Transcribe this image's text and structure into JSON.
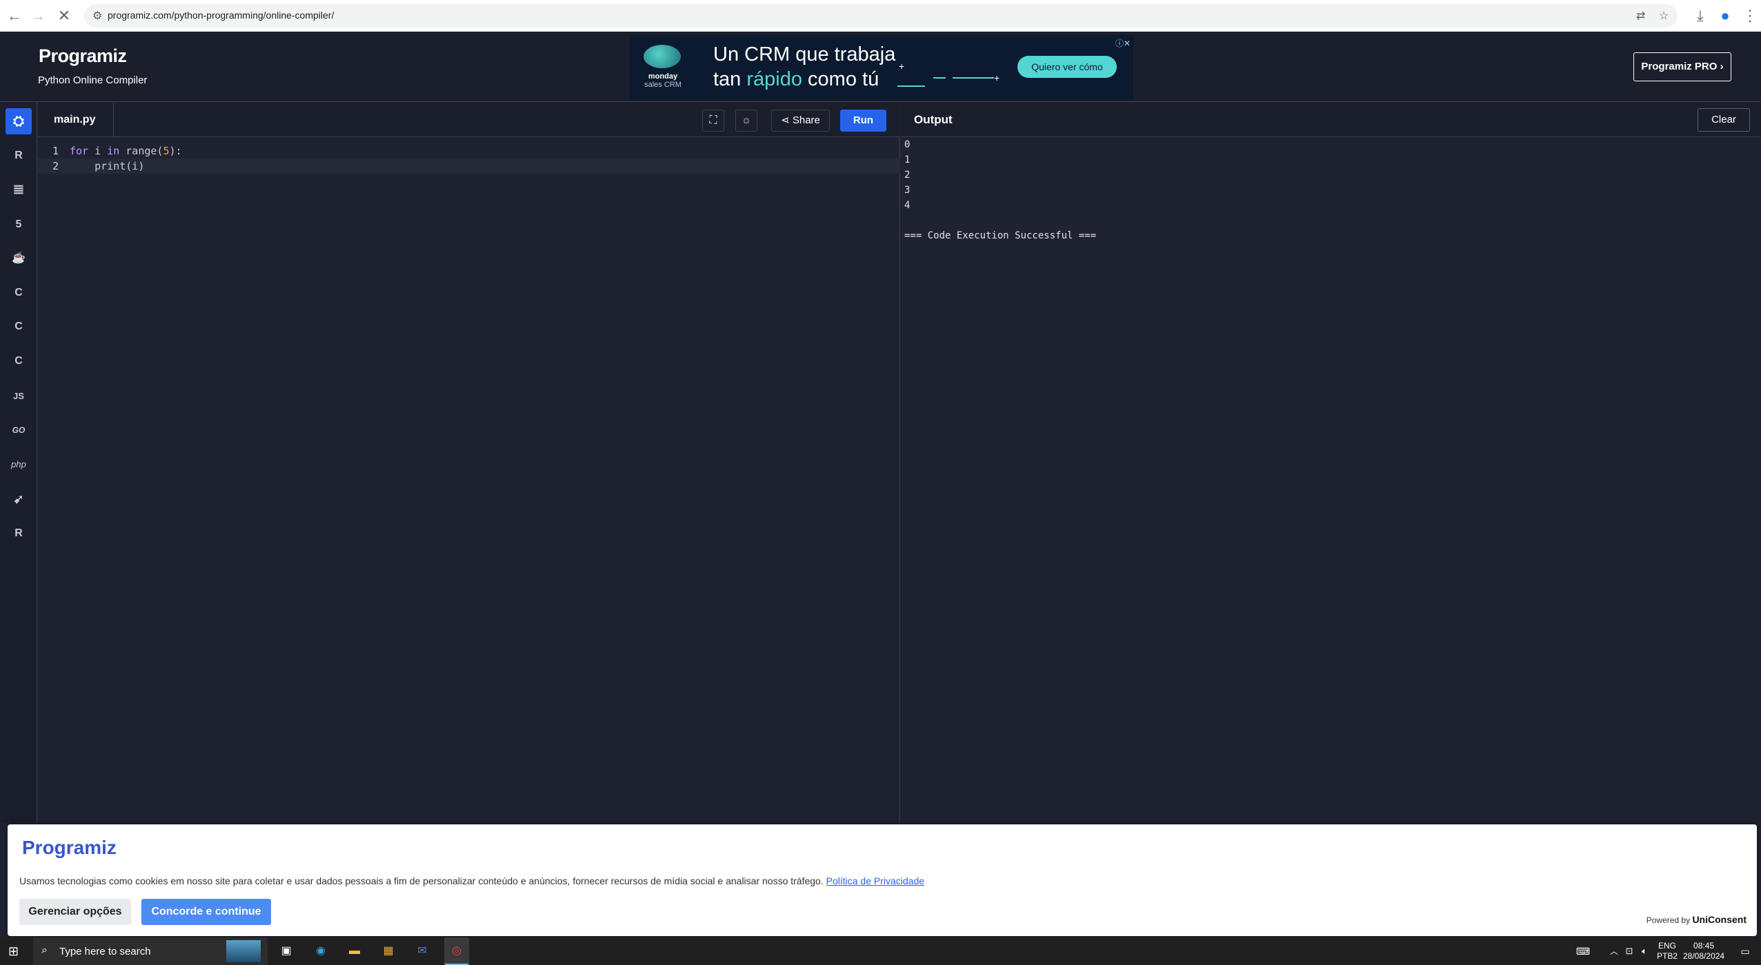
{
  "browser": {
    "url": "programiz.com/python-programming/online-compiler/"
  },
  "header": {
    "logo": "Programiz",
    "subtitle": "Python Online Compiler",
    "pro_button": "Programiz PRO ›"
  },
  "ad": {
    "brand_line1": "monday",
    "brand_line2": "sales CRM",
    "headline_line1": "Un CRM que trabaja",
    "headline_line2_a": "tan ",
    "headline_line2_b": "rápido",
    "headline_line2_c": " como tú",
    "cta": "Quiero ver cómo"
  },
  "sidebar": {
    "items": [
      {
        "icon": "python-icon",
        "label": "",
        "active": true
      },
      {
        "icon": "r-icon",
        "label": "R"
      },
      {
        "icon": "sql-icon",
        "label": ""
      },
      {
        "icon": "html-icon",
        "label": "5"
      },
      {
        "icon": "java-icon",
        "label": "☕"
      },
      {
        "icon": "c-icon",
        "label": "C"
      },
      {
        "icon": "cpp-icon",
        "label": "C"
      },
      {
        "icon": "csharp-icon",
        "label": "C"
      },
      {
        "icon": "javascript-icon",
        "label": "JS"
      },
      {
        "icon": "go-icon",
        "label": "GO"
      },
      {
        "icon": "php-icon",
        "label": "php"
      },
      {
        "icon": "swift-icon",
        "label": ""
      },
      {
        "icon": "rust-icon",
        "label": "R"
      }
    ]
  },
  "editor": {
    "filename": "main.py",
    "share_label": "Share",
    "run_label": "Run",
    "lines": [
      {
        "number": "1",
        "kw1": "for",
        "a": " i ",
        "kw2": "in",
        "b": " range(",
        "num": "5",
        "c": "):"
      },
      {
        "number": "2",
        "text": "    print(i)"
      }
    ]
  },
  "output": {
    "title": "Output",
    "clear_label": "Clear",
    "lines": [
      "0",
      "1",
      "2",
      "3",
      "4",
      "",
      "=== Code Execution Successful ==="
    ]
  },
  "cookie": {
    "logo": "Programiz",
    "text": "Usamos tecnologias como cookies em nosso site para coletar e usar dados pessoais a fim de personalizar conteúdo e anúncios, fornecer recursos de mídia social e analisar nosso tráfego. ",
    "link": "Política de Privacidade",
    "manage_label": "Gerenciar opções",
    "agree_label": "Concorde e continue",
    "powered_prefix": "Powered by ",
    "powered_brand": "UniConsent"
  },
  "taskbar": {
    "search_placeholder": "Type here to search",
    "lang_line1": "ENG",
    "lang_line2": "PTB2",
    "time": "08:45",
    "date": "28/08/2024"
  }
}
